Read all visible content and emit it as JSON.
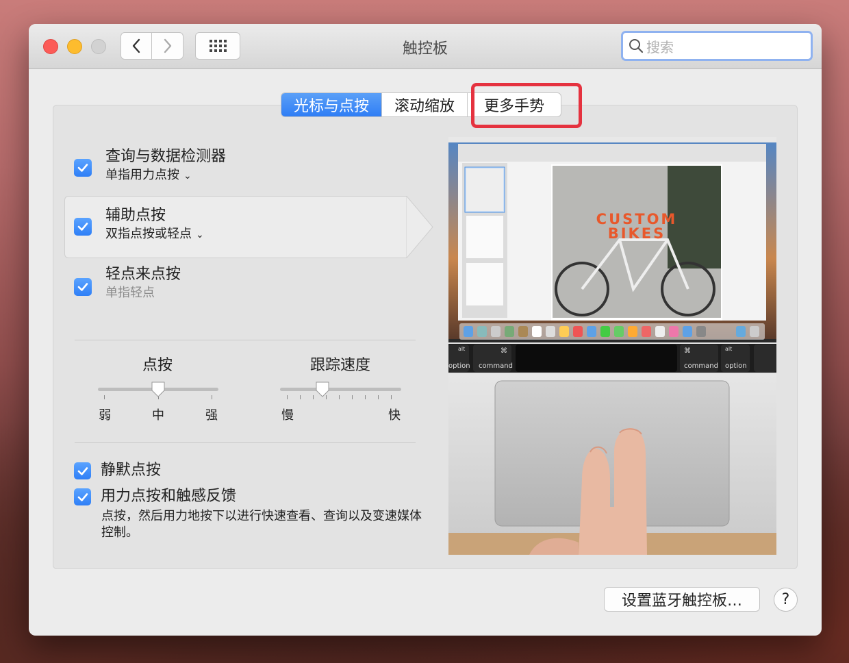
{
  "window": {
    "title": "触控板"
  },
  "search": {
    "placeholder": "搜索"
  },
  "tabs": [
    {
      "label": "光标与点按",
      "active": true
    },
    {
      "label": "滚动缩放",
      "active": false
    },
    {
      "label": "更多手势",
      "active": false
    }
  ],
  "options": [
    {
      "title": "查询与数据检测器",
      "subtitle": "单指用力点按",
      "checked": true,
      "has_dropdown": true
    },
    {
      "title": "辅助点按",
      "subtitle": "双指点按或轻点",
      "checked": true,
      "has_dropdown": true
    },
    {
      "title": "轻点来点按",
      "subtitle": "单指轻点",
      "checked": true,
      "has_dropdown": false
    }
  ],
  "sliders": {
    "click": {
      "label": "点按",
      "min_label": "弱",
      "mid_label": "中",
      "max_label": "强",
      "value": 0.5
    },
    "tracking": {
      "label": "跟踪速度",
      "min_label": "慢",
      "max_label": "快",
      "value": 0.35
    }
  },
  "bottom_options": [
    {
      "title": "静默点按",
      "checked": true
    },
    {
      "title": "用力点按和触感反馈",
      "checked": true
    }
  ],
  "force_click_description": "点按，然后用力地按下以进行快速查看、查询以及变速媒体控制。",
  "preview": {
    "poster_title_line1": "CUSTOM",
    "poster_title_line2": "BIKES",
    "touchbar_keys": [
      "alt",
      "option",
      "command",
      "⌘",
      "command",
      "alt",
      "option"
    ]
  },
  "buttons": {
    "bluetooth": "设置蓝牙触控板…",
    "help": "?"
  },
  "colors": {
    "accent": "#2f7ef5",
    "highlight_box": "#e5323f"
  }
}
